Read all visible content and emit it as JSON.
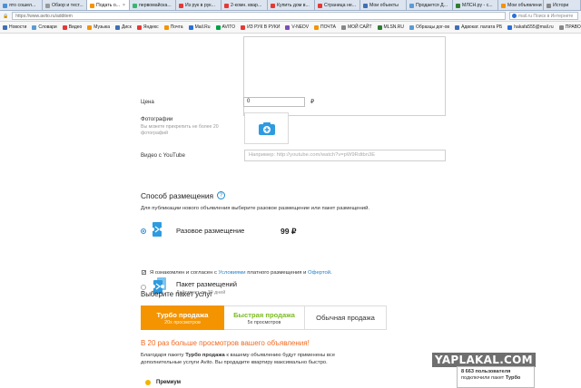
{
  "browser": {
    "tabs": [
      {
        "label": "ято сошел...",
        "color": "#4a90d9",
        "active": false
      },
      {
        "label": "Обзор и тест...",
        "color": "#999999",
        "active": false
      },
      {
        "label": "Подать о...",
        "color": "#f39400",
        "active": true
      },
      {
        "label": "первомайска...",
        "color": "#3cb371",
        "active": false
      },
      {
        "label": "Из рук в рук...",
        "color": "#e53935",
        "active": false
      },
      {
        "label": "2-комн. квар...",
        "color": "#e53935",
        "active": false
      },
      {
        "label": "Купить дом в...",
        "color": "#e53935",
        "active": false
      },
      {
        "label": "Страница не...",
        "color": "#e53935",
        "active": false
      },
      {
        "label": "Мои объекты",
        "color": "#3f6fb5",
        "active": false
      },
      {
        "label": "Продается Д...",
        "color": "#5a9bd5",
        "active": false
      },
      {
        "label": "МЛСН.ру - с...",
        "color": "#2e7d32",
        "active": false
      },
      {
        "label": "Мои объявлени",
        "color": "#f39400",
        "active": false
      },
      {
        "label": "Истори",
        "color": "#888888",
        "active": false
      }
    ],
    "url": "https://www.avito.ru/additem",
    "search_placeholder": "mail.ru Поиск в Интернете",
    "bookmarks": [
      {
        "label": "Новости",
        "color": "#3f6fb5"
      },
      {
        "label": "Словари",
        "color": "#5a9bd5"
      },
      {
        "label": "Видео",
        "color": "#e53935"
      },
      {
        "label": "Музыка",
        "color": "#f39400"
      },
      {
        "label": "Диск",
        "color": "#3f6fb5"
      },
      {
        "label": "Яндекс",
        "color": "#e53935"
      },
      {
        "label": "Почта",
        "color": "#f39400"
      },
      {
        "label": "Mail.Ru",
        "color": "#2a6fdb"
      },
      {
        "label": "AVITO",
        "color": "#00a046"
      },
      {
        "label": "ИЗ РУК В РУКИ",
        "color": "#e53935"
      },
      {
        "label": "V-NEDV",
        "color": "#7b4fb5"
      },
      {
        "label": "ПОЧТА",
        "color": "#f39400"
      },
      {
        "label": "МОЙ САЙТ",
        "color": "#888888"
      },
      {
        "label": "MLSN.RU",
        "color": "#2e7d32"
      },
      {
        "label": "Образцы дог-ов",
        "color": "#5a9bd5"
      },
      {
        "label": "Адвокат. палата РБ",
        "color": "#3f6fb5"
      },
      {
        "label": "hakafa555@mail.ru",
        "color": "#2a6fdb"
      },
      {
        "label": "ПРАВО конкуре",
        "color": "#888888"
      }
    ]
  },
  "form": {
    "price_label": "Цена",
    "price_value": "0",
    "currency": "₽",
    "photos_label": "Фотографии",
    "photos_hint": "Вы можете прикрепить не более 20 фотографий",
    "youtube_label": "Видео с YouTube",
    "youtube_placeholder": "Например: http://youtube.com/watch?v=pW9Rdtbn3E"
  },
  "placement": {
    "title": "Способ размещения",
    "help_glyph": "?",
    "note": "Для публикации нового объявления выберите разовое размещение или пакет размещений.",
    "single_label": "Разовое размещение",
    "single_price": "99 ₽",
    "package_label": "Пакет размещений",
    "package_sub": "Действует до 30 дней",
    "agree_prefix": "Я ознакомлен и согласен с",
    "agree_link1": "Условиями",
    "agree_middle": "платного размещения и",
    "agree_link2": "Офертой",
    "agree_suffix": "."
  },
  "services": {
    "title": "Выберите пакет услуг",
    "turbo_name": "Турбо продажа",
    "turbo_sub": "20x просмотров",
    "fast_name": "Быстрая продажа",
    "fast_sub": "5x просмотров",
    "normal_name": "Обычная продажа",
    "promo_head": "В 20 раз больше просмотров вашего объявления!",
    "promo_before": "Благодаря пакету",
    "promo_bold": "Турбо продажа",
    "promo_after": "к вашему объявлению будут применены все дополнительные услуги Avito. Вы продадите квартиру максимально быстро.",
    "premium": "Премиум"
  },
  "watermark": {
    "brand": "YAPLAKAL.COM",
    "line1": "8 663 пользователя",
    "line2_prefix": "подключили пакет",
    "line2_bold": "Турбо"
  },
  "colors": {
    "accent_orange": "#f39400",
    "accent_green": "#7dbb23",
    "link_blue": "#1e7fc8",
    "promo_orange": "#f26a21"
  }
}
